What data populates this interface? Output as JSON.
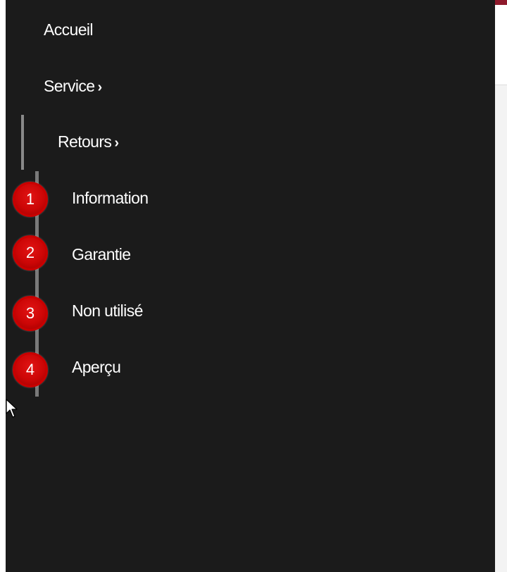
{
  "colors": {
    "nav_background": "#1b1b1b",
    "accent": "#8e1a2c",
    "marker_red": "#d60a0a"
  },
  "nav": {
    "home": "Accueil",
    "service": "Service",
    "returns": "Retours",
    "chevron": "›",
    "sub_items": [
      {
        "number": "1",
        "label": "Information"
      },
      {
        "number": "2",
        "label": "Garantie"
      },
      {
        "number": "3",
        "label": "Non utilisé"
      },
      {
        "number": "4",
        "label": "Aperçu"
      }
    ]
  },
  "icons": {
    "chevron": "chevron-right-icon",
    "cursor": "mouse-pointer-icon"
  }
}
